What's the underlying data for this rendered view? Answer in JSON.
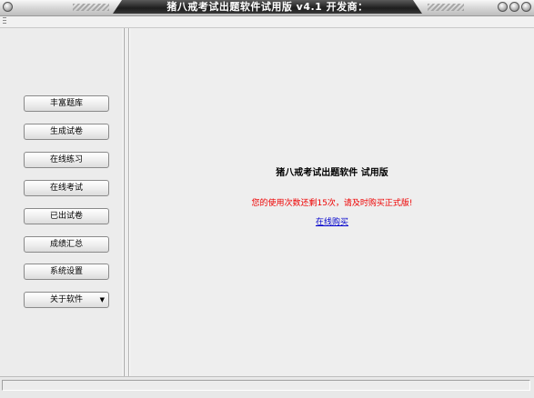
{
  "window": {
    "title": "猪八戒考试出题软件试用版 v4.1 开发商："
  },
  "nav": {
    "items": [
      {
        "label": "丰富题库",
        "has_menu": false
      },
      {
        "label": "生成试卷",
        "has_menu": false
      },
      {
        "label": "在线练习",
        "has_menu": false
      },
      {
        "label": "在线考试",
        "has_menu": false
      },
      {
        "label": "已出试卷",
        "has_menu": false
      },
      {
        "label": "成绩汇总",
        "has_menu": false
      },
      {
        "label": "系统设置",
        "has_menu": false
      },
      {
        "label": "关于软件",
        "has_menu": true
      }
    ]
  },
  "main": {
    "heading": "猪八戒考试出题软件 试用版",
    "warning": "您的使用次数还剩15次，请及时购买正式版!",
    "buy_link": "在线购买"
  },
  "status": {
    "text": ""
  },
  "colors": {
    "warning": "#ee0000",
    "link": "#0000cc"
  }
}
